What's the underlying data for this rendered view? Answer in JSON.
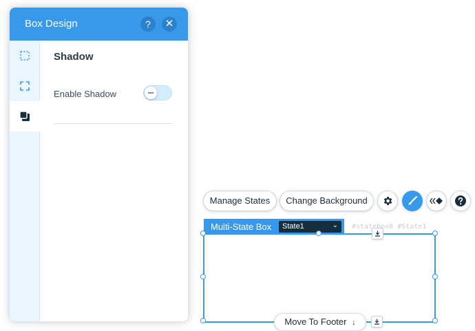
{
  "panel": {
    "title": "Box Design",
    "help_glyph": "?",
    "close_glyph": "✕",
    "tabs": [
      {
        "icon": "dashed-square-icon"
      },
      {
        "icon": "corners-square-icon"
      },
      {
        "icon": "shadow-squares-icon",
        "active": true
      }
    ],
    "section_title": "Shadow",
    "option_label": "Enable Shadow",
    "toggle_state": "off"
  },
  "toolbar": {
    "manage_states": "Manage States",
    "change_background": "Change Background",
    "icons": [
      "gear-icon",
      "brush-icon",
      "animation-icon",
      "help-icon"
    ]
  },
  "element": {
    "type_label": "Multi-State Box",
    "state_value": "State1",
    "ghost_ids": "#statebox8  #State1",
    "footer_button": "Move To Footer",
    "footer_arrow": "↓"
  },
  "colors": {
    "accent": "#3899ec",
    "dark": "#162d3d",
    "sidebar_bg": "#eaf6ff"
  }
}
